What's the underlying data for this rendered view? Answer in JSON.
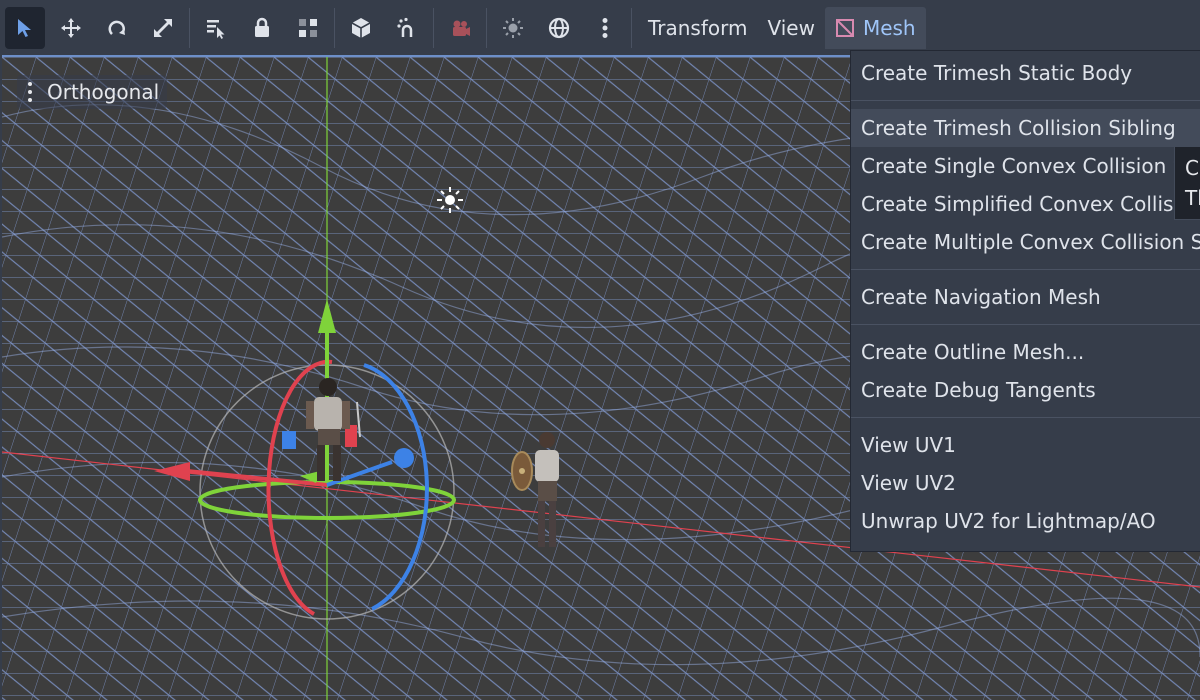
{
  "toolbar": {
    "buttons": [
      {
        "name": "select-tool",
        "icon": "cursor-arrow-icon",
        "active": true
      },
      {
        "name": "move-tool",
        "icon": "move-arrows-icon"
      },
      {
        "name": "rotate-tool",
        "icon": "rotate-icon"
      },
      {
        "name": "scale-tool",
        "icon": "scale-icon"
      },
      {
        "name": "list-select-tool",
        "icon": "list-select-icon"
      },
      {
        "name": "lock-button",
        "icon": "lock-icon"
      },
      {
        "name": "group-button",
        "icon": "group-icon"
      },
      {
        "name": "local-space-button",
        "icon": "cube-icon"
      },
      {
        "name": "snap-button",
        "icon": "snap-magnet-icon"
      },
      {
        "name": "camera-preview-button",
        "icon": "camera-icon"
      },
      {
        "name": "sun-toggle-button",
        "icon": "sun-icon"
      },
      {
        "name": "environment-toggle-button",
        "icon": "globe-icon"
      },
      {
        "name": "more-options-button",
        "icon": "kebab-menu-icon"
      }
    ],
    "menus": {
      "transform": "Transform",
      "view": "View",
      "mesh": "Mesh"
    }
  },
  "viewport": {
    "view_label": "Orthogonal"
  },
  "mesh_menu": {
    "items": [
      "Create Trimesh Static Body",
      "Create Trimesh Collision Sibling",
      "Create Single Convex Collision Sibling",
      "Create Simplified Convex Collision Sibling",
      "Create Multiple Convex Collision Siblings",
      "Create Navigation Mesh",
      "Create Outline Mesh...",
      "Create Debug Tangents",
      "View UV1",
      "View UV2",
      "Unwrap UV2 for Lightmap/AO"
    ],
    "hovered_index": 1
  },
  "tooltip": {
    "line1": "Cr",
    "line2": "Th"
  },
  "colors": {
    "accent": "#9fc5f8",
    "axis_x": "#e0424f",
    "axis_y": "#7fd33a",
    "axis_z": "#3d82e6",
    "wire": "#8aa7e6"
  }
}
